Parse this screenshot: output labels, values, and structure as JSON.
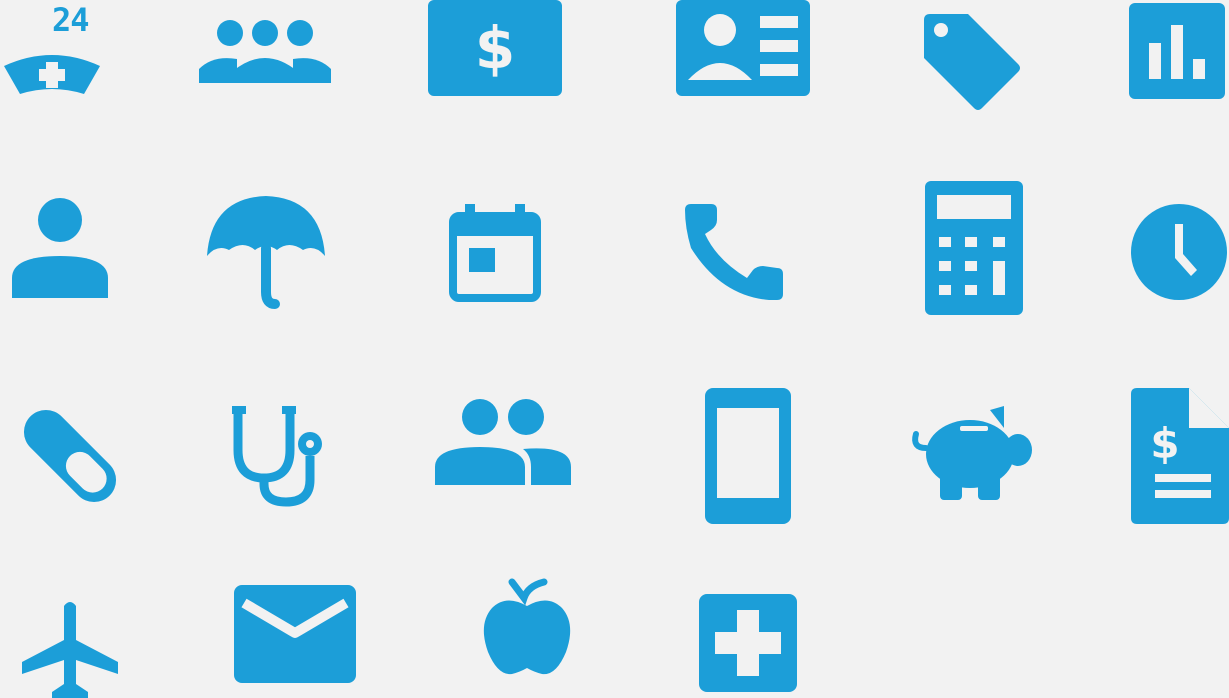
{
  "palette": {
    "icon": "#1c9ed8",
    "background": "#f2f2f2",
    "cutout": "#f2f2f2"
  },
  "icons": {
    "nurse_badge": "24",
    "currency_symbol": "$",
    "invoice_symbol": "$"
  },
  "icon_names": [
    "nurse-cap-24-icon",
    "group-icon",
    "dollar-bill-icon",
    "id-card-icon",
    "price-tag-icon",
    "bar-chart-icon",
    "person-icon",
    "umbrella-icon",
    "calendar-icon",
    "phone-icon",
    "calculator-icon",
    "clock-icon",
    "pill-icon",
    "stethoscope-icon",
    "people-icon",
    "tablet-icon",
    "piggy-bank-icon",
    "invoice-icon",
    "airplane-icon",
    "mail-icon",
    "apple-icon",
    "medical-cross-icon"
  ]
}
